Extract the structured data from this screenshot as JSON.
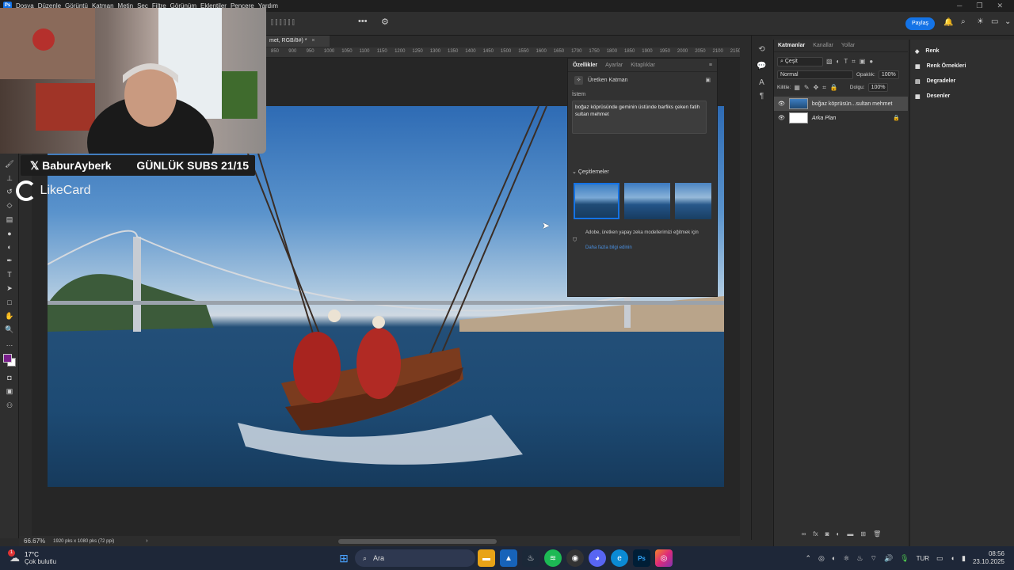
{
  "menu": [
    "Dosya",
    "Düzenle",
    "Görüntü",
    "Katman",
    "Metin",
    "Seç",
    "Filtre",
    "Görünüm",
    "Eklentiler",
    "Pencere",
    "Yardım"
  ],
  "share_label": "Paylaş",
  "doc_tab": "met, RGB/8#) *",
  "ruler_ticks": [
    "850",
    "900",
    "950",
    "1000",
    "1050",
    "1100",
    "1150",
    "1200",
    "1250",
    "1300",
    "1350",
    "1400",
    "1450",
    "1500",
    "1550",
    "1600",
    "1650",
    "1700",
    "1750",
    "1800",
    "1850",
    "1900",
    "1950",
    "2000",
    "2050",
    "2100",
    "2150"
  ],
  "overlay": {
    "handle": "BaburAyberk",
    "subs": "GÜNLÜK SUBS 21/15",
    "sponsor": "LikeCard"
  },
  "properties": {
    "tabs": [
      "Özellikler",
      "Ayarlar",
      "Kitaplıklar"
    ],
    "layer_type": "Üretken Katman",
    "prompt_label": "İstem",
    "prompt_text": "boğaz köprüsünde geminin üstünde barfiks çeken fatih sultan mehmet",
    "variations_label": "Çeşitlemeler",
    "disclaimer": "Adobe, üretken yapay zeka modellerimizi eğitmek için",
    "learn_more": "Daha fazla bilgi edinin"
  },
  "layers": {
    "tabs": [
      "Katmanlar",
      "Kanallar",
      "Yollar"
    ],
    "kind": "Çeşit",
    "blend_mode": "Normal",
    "opacity_label": "Opaklık:",
    "opacity": "100%",
    "lock_label": "Kilitle:",
    "fill_label": "Dolgu:",
    "fill": "100%",
    "items": [
      {
        "name": "boğaz köprüsün...sultan mehmet"
      },
      {
        "name": "Arka Plan"
      }
    ]
  },
  "far_right": [
    "Renk",
    "Renk Örnekleri",
    "Degradeler",
    "Desenler"
  ],
  "status": {
    "zoom": "66.67%",
    "size": "1920 pks x 1080 pks (72 ppi)"
  },
  "taskbar": {
    "weather_temp": "17°C",
    "weather_desc": "Çok bulutlu",
    "weather_badge": "1",
    "search_label": "Ara",
    "lang": "TUR",
    "time": "08:56",
    "date": "23.10.2025"
  },
  "colors": {
    "accent": "#1473e6",
    "foreground": "#7a1f8c",
    "background": "#ffffff"
  }
}
